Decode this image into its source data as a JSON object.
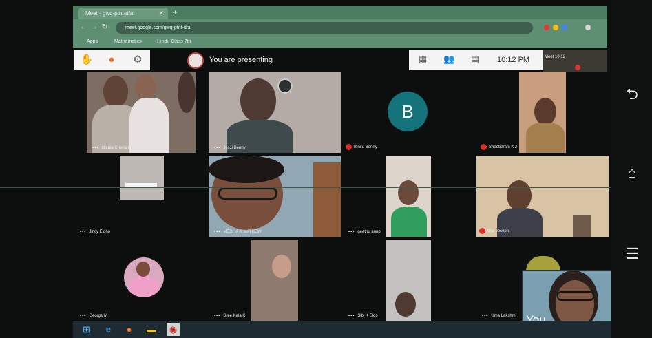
{
  "browser": {
    "tab_title": "Meet - gwq-ptnt-dfa",
    "new_tab": "+",
    "url": "meet.google.com/gwq-ptnt-dfa",
    "bookmarks": [
      "Apps",
      "Mathematics",
      "Hindu Class 7th"
    ]
  },
  "meet": {
    "presenting_text": "You are presenting",
    "clock": "10:12 PM",
    "mini_tile_text": "Meet\n10:12"
  },
  "participants": [
    {
      "name": "Idicula Cherian",
      "muted": false
    },
    {
      "name": "Jossi Benny",
      "muted": false
    },
    {
      "name": "Binsu Benny",
      "initial": "B",
      "muted": true
    },
    {
      "name": "Sheebarani K J",
      "muted": true
    },
    {
      "name": "Jincy Eldho",
      "muted": false
    },
    {
      "name": "MEGHA K MATHEW",
      "muted": false
    },
    {
      "name": "geethu anup",
      "muted": false
    },
    {
      "name": "Sija Joseph",
      "muted": true
    },
    {
      "name": "George M",
      "muted": false
    },
    {
      "name": "Sree Kala K",
      "muted": false
    },
    {
      "name": "Sibi K Eldo",
      "muted": false
    },
    {
      "name": "Uma Lakshmi",
      "muted": false
    }
  ],
  "self_view": {
    "label": "You"
  },
  "android_nav": {
    "back": "⮌",
    "home": "⌂",
    "recents": "☰"
  },
  "taskbar": {
    "items": [
      "windows-start",
      "edge",
      "firefox",
      "file-explorer",
      "chrome"
    ]
  }
}
